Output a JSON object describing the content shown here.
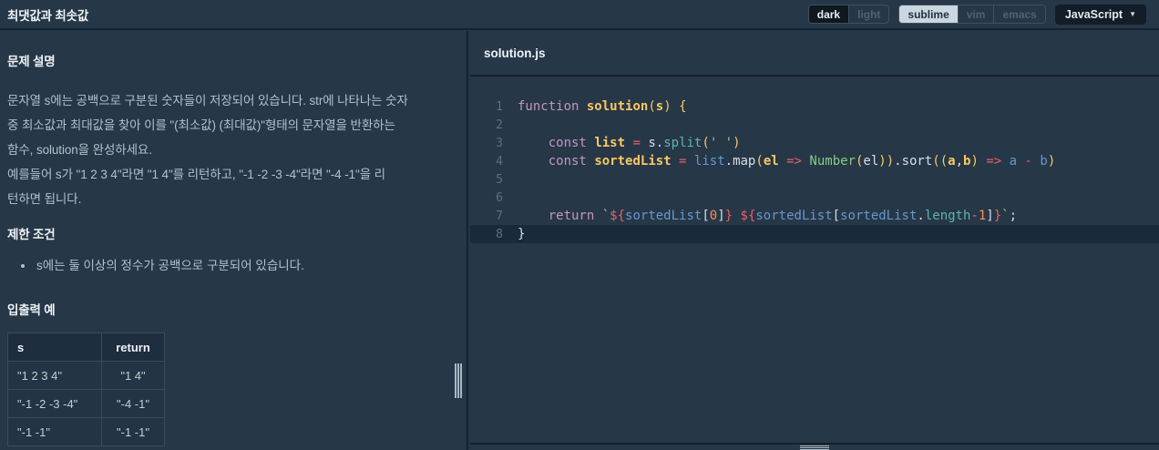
{
  "colors": {
    "css_vars": {
      "bg": "#263747",
      "border-dark": "#16222e",
      "text-head": "#eef2f6",
      "text-body": "#b2c0cb",
      "gutter": "#5b7082",
      "active-line": "#1b2a3a",
      "tbl-border": "#384c5f",
      "tbl-head-bg": "#1e2e3e",
      "tbl-body-bg": "#243444",
      "seg-border": "#3e5061",
      "seg-inactive": "#506274",
      "seg-dark-bg": "#0f171f",
      "seg-light-bg": "#cad7e1",
      "seg-light-text": "#22313f",
      "dd-bg": "#131d27",
      "handle": "#a7b8c5",
      "c-k": "#c594c5",
      "c-d": "#fac863",
      "c-v": "#6699cc",
      "c-o": "#ec5f67",
      "c-s": "#99c794",
      "c-m": "#5fb3b3",
      "c-g": "#8ac985",
      "c-n": "#f99157",
      "c-y": "#fac863",
      "c-w": "#d8dee9"
    }
  },
  "topbar": {
    "title": "최댓값과 최솟값",
    "theme_toggle": {
      "options": [
        "dark",
        "light"
      ],
      "active": "dark"
    },
    "keymap_toggle": {
      "options": [
        "sublime",
        "vim",
        "emacs"
      ],
      "active": "sublime"
    },
    "language_dropdown": {
      "label": "JavaScript",
      "caret": "▼"
    }
  },
  "problem": {
    "section_description_title": "문제 설명",
    "description_lines": [
      "문자열 s에는 공백으로 구분된 숫자들이 저장되어 있습니다. str에 나타나는 숫자",
      "중 최소값과 최대값을 찾아 이를 \"(최소값) (최대값)\"형태의 문자열을 반환하는",
      "함수, solution을 완성하세요.",
      "예를들어 s가 \"1 2 3 4\"라면 \"1 4\"를 리턴하고, \"-1 -2 -3 -4\"라면 \"-4 -1\"을 리",
      "턴하면 됩니다."
    ],
    "section_constraints_title": "제한 조건",
    "constraints": [
      "s에는 둘 이상의 정수가 공백으로 구분되어 있습니다."
    ],
    "section_io_title": "입출력 예",
    "io_table": {
      "headers": [
        "s",
        "return"
      ],
      "rows": [
        [
          "\"1 2 3 4\"",
          "\"1 4\""
        ],
        [
          "\"-1 -2 -3 -4\"",
          "\"-4 -1\""
        ],
        [
          "\"-1 -1\"",
          "\"-1 -1\""
        ]
      ]
    }
  },
  "editor": {
    "filename": "solution.js",
    "active_line": 8,
    "lines": [
      {
        "n": 1,
        "tokens": [
          [
            "k",
            "function"
          ],
          [
            "w",
            " "
          ],
          [
            "d",
            "solution"
          ],
          [
            "y",
            "("
          ],
          [
            "d",
            "s"
          ],
          [
            "y",
            ")"
          ],
          [
            "w",
            " "
          ],
          [
            "y",
            "{"
          ]
        ]
      },
      {
        "n": 2,
        "tokens": []
      },
      {
        "n": 3,
        "tokens": [
          [
            "w",
            "    "
          ],
          [
            "k",
            "const"
          ],
          [
            "w",
            " "
          ],
          [
            "d",
            "list"
          ],
          [
            "w",
            " "
          ],
          [
            "o",
            "="
          ],
          [
            "w",
            " "
          ],
          [
            "w",
            "s"
          ],
          [
            "w",
            "."
          ],
          [
            "m",
            "split"
          ],
          [
            "y",
            "("
          ],
          [
            "s",
            "' '"
          ],
          [
            "y",
            ")"
          ]
        ]
      },
      {
        "n": 4,
        "tokens": [
          [
            "w",
            "    "
          ],
          [
            "k",
            "const"
          ],
          [
            "w",
            " "
          ],
          [
            "d",
            "sortedList"
          ],
          [
            "w",
            " "
          ],
          [
            "o",
            "="
          ],
          [
            "w",
            " "
          ],
          [
            "v",
            "list"
          ],
          [
            "w",
            "."
          ],
          [
            "w",
            "map"
          ],
          [
            "y",
            "("
          ],
          [
            "d",
            "el"
          ],
          [
            "w",
            " "
          ],
          [
            "o",
            "=>"
          ],
          [
            "w",
            " "
          ],
          [
            "g",
            "Number"
          ],
          [
            "y",
            "("
          ],
          [
            "w",
            "el"
          ],
          [
            "y",
            "))"
          ],
          [
            "w",
            "."
          ],
          [
            "w",
            "sort"
          ],
          [
            "y",
            "(("
          ],
          [
            "d",
            "a"
          ],
          [
            "w",
            ","
          ],
          [
            "d",
            "b"
          ],
          [
            "y",
            ")"
          ],
          [
            "w",
            " "
          ],
          [
            "o",
            "=>"
          ],
          [
            "w",
            " "
          ],
          [
            "v",
            "a"
          ],
          [
            "w",
            " "
          ],
          [
            "o",
            "-"
          ],
          [
            "w",
            " "
          ],
          [
            "v",
            "b"
          ],
          [
            "y",
            ")"
          ]
        ]
      },
      {
        "n": 5,
        "tokens": []
      },
      {
        "n": 6,
        "tokens": []
      },
      {
        "n": 7,
        "tokens": [
          [
            "w",
            "    "
          ],
          [
            "k",
            "return"
          ],
          [
            "w",
            " "
          ],
          [
            "s",
            "`"
          ],
          [
            "o",
            "${"
          ],
          [
            "v",
            "sortedList"
          ],
          [
            "w",
            "["
          ],
          [
            "n",
            "0"
          ],
          [
            "w",
            "]"
          ],
          [
            "o",
            "}"
          ],
          [
            "s",
            " "
          ],
          [
            "o",
            "${"
          ],
          [
            "v",
            "sortedList"
          ],
          [
            "w",
            "["
          ],
          [
            "v",
            "sortedList"
          ],
          [
            "w",
            "."
          ],
          [
            "m",
            "length"
          ],
          [
            "o",
            "-"
          ],
          [
            "n",
            "1"
          ],
          [
            "w",
            "]"
          ],
          [
            "o",
            "}"
          ],
          [
            "s",
            "`"
          ],
          [
            "w",
            ";"
          ]
        ]
      },
      {
        "n": 8,
        "tokens": [
          [
            "w",
            "}"
          ]
        ]
      }
    ]
  }
}
